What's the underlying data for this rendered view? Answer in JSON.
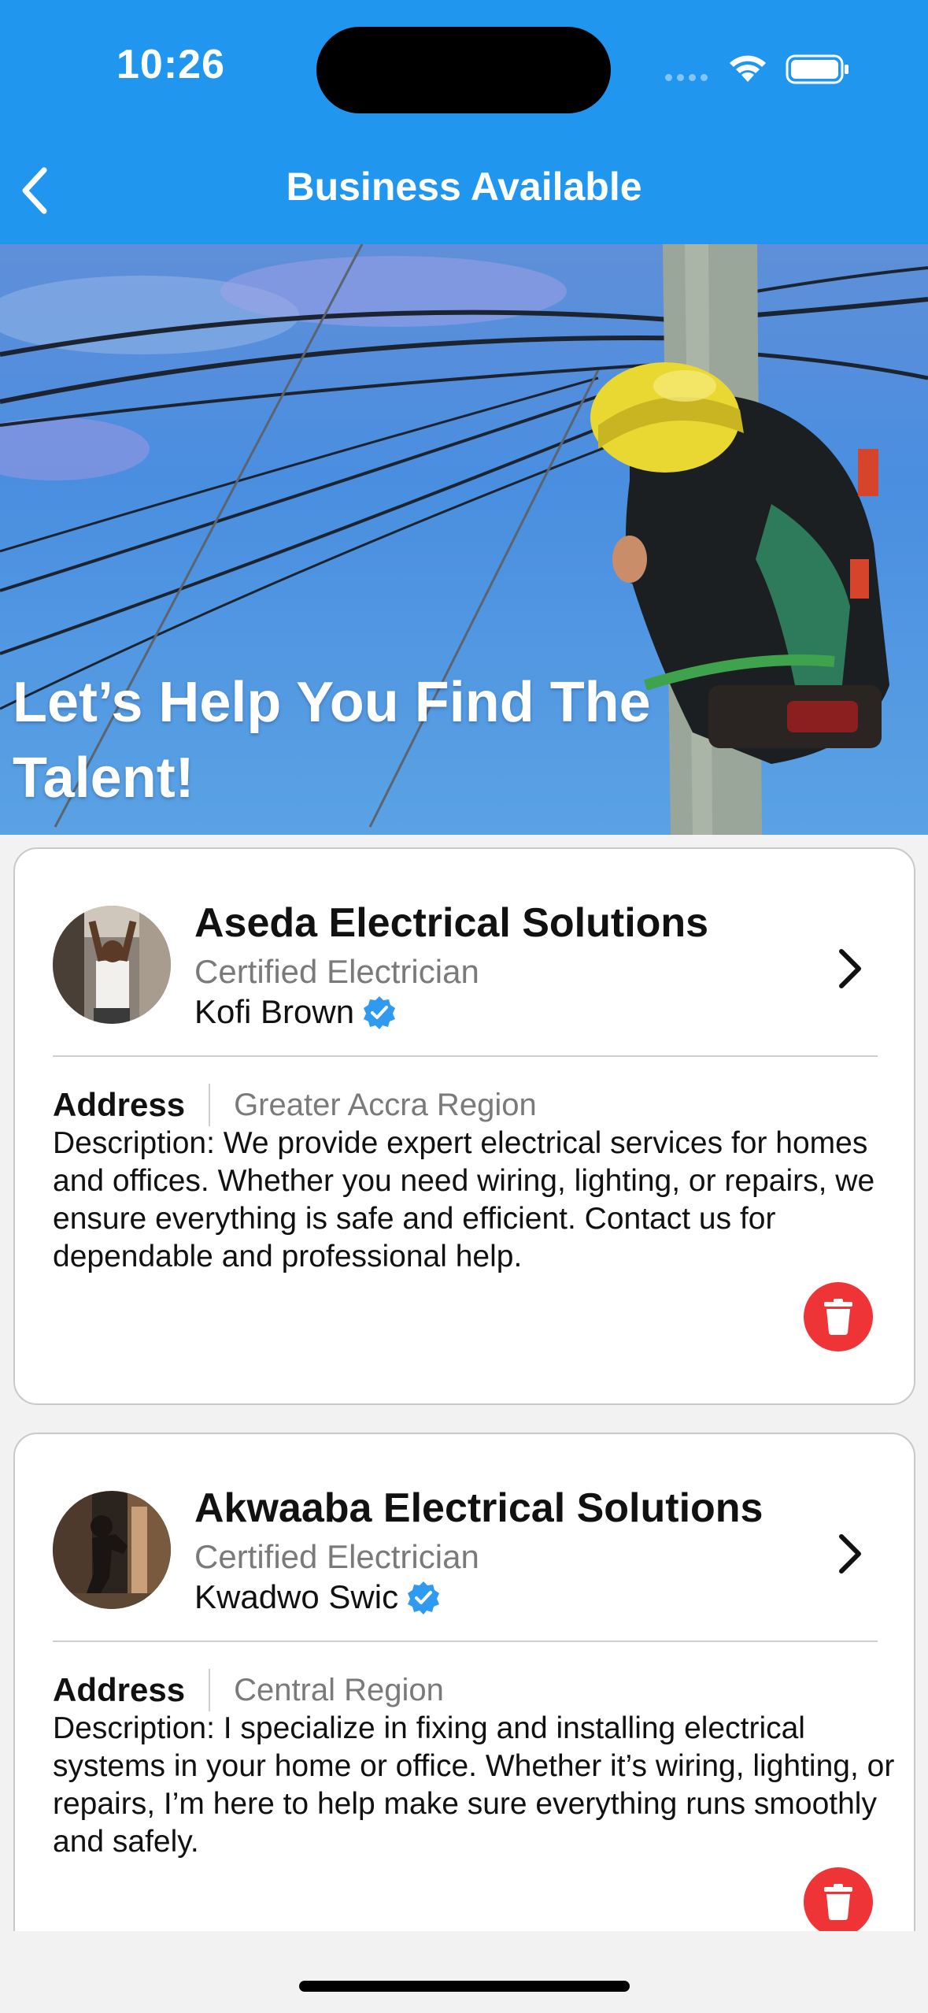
{
  "status_bar": {
    "time": "10:26"
  },
  "nav": {
    "title": "Business Available",
    "back_icon": "chevron-left-icon"
  },
  "hero": {
    "title": "Let’s Help You Find The Talent!"
  },
  "colors": {
    "primary": "#2196ef",
    "delete": "#ee3437",
    "verified": "#2f9bf0"
  },
  "listings": [
    {
      "business_name": "Aseda Electrical Solutions",
      "role": "Certified Electrician",
      "owner": "Kofi Brown",
      "address_label": "Address",
      "address_value": "Greater Accra Region",
      "description": "Description: We provide expert electrical services for homes and offices. Whether you need wiring, lighting, or repairs, we ensure everything is safe and efficient. Contact us for dependable and professional help."
    },
    {
      "business_name": "Akwaaba Electrical Solutions",
      "role": "Certified Electrician",
      "owner": "Kwadwo Swic",
      "address_label": "Address",
      "address_value": "Central Region",
      "description": "Description: I specialize in fixing and installing electrical systems in your home or office. Whether it’s wiring, lighting, or repairs, I’m here to help make sure everything runs smoothly and safely."
    }
  ]
}
